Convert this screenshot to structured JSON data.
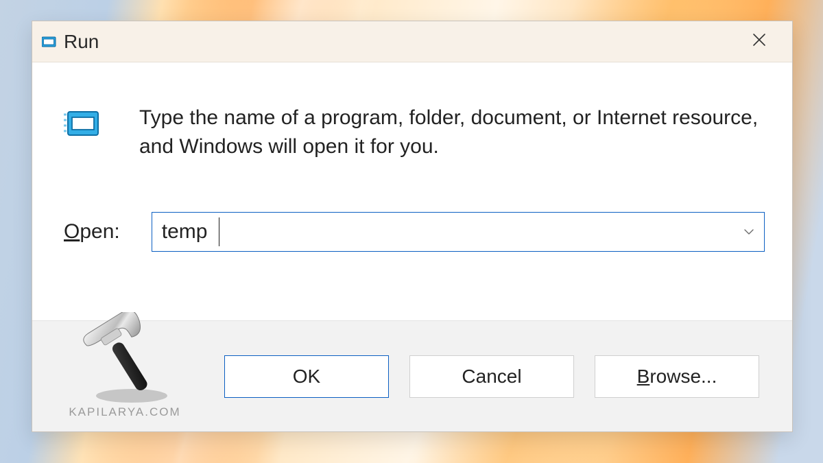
{
  "dialog": {
    "title": "Run",
    "description": "Type the name of a program, folder, document, or Internet resource, and Windows will open it for you.",
    "open_label_html": "Open:",
    "input_value": "temp",
    "buttons": {
      "ok": "OK",
      "cancel": "Cancel",
      "browse": "Browse..."
    }
  },
  "watermark": "KAPILARYA.COM"
}
